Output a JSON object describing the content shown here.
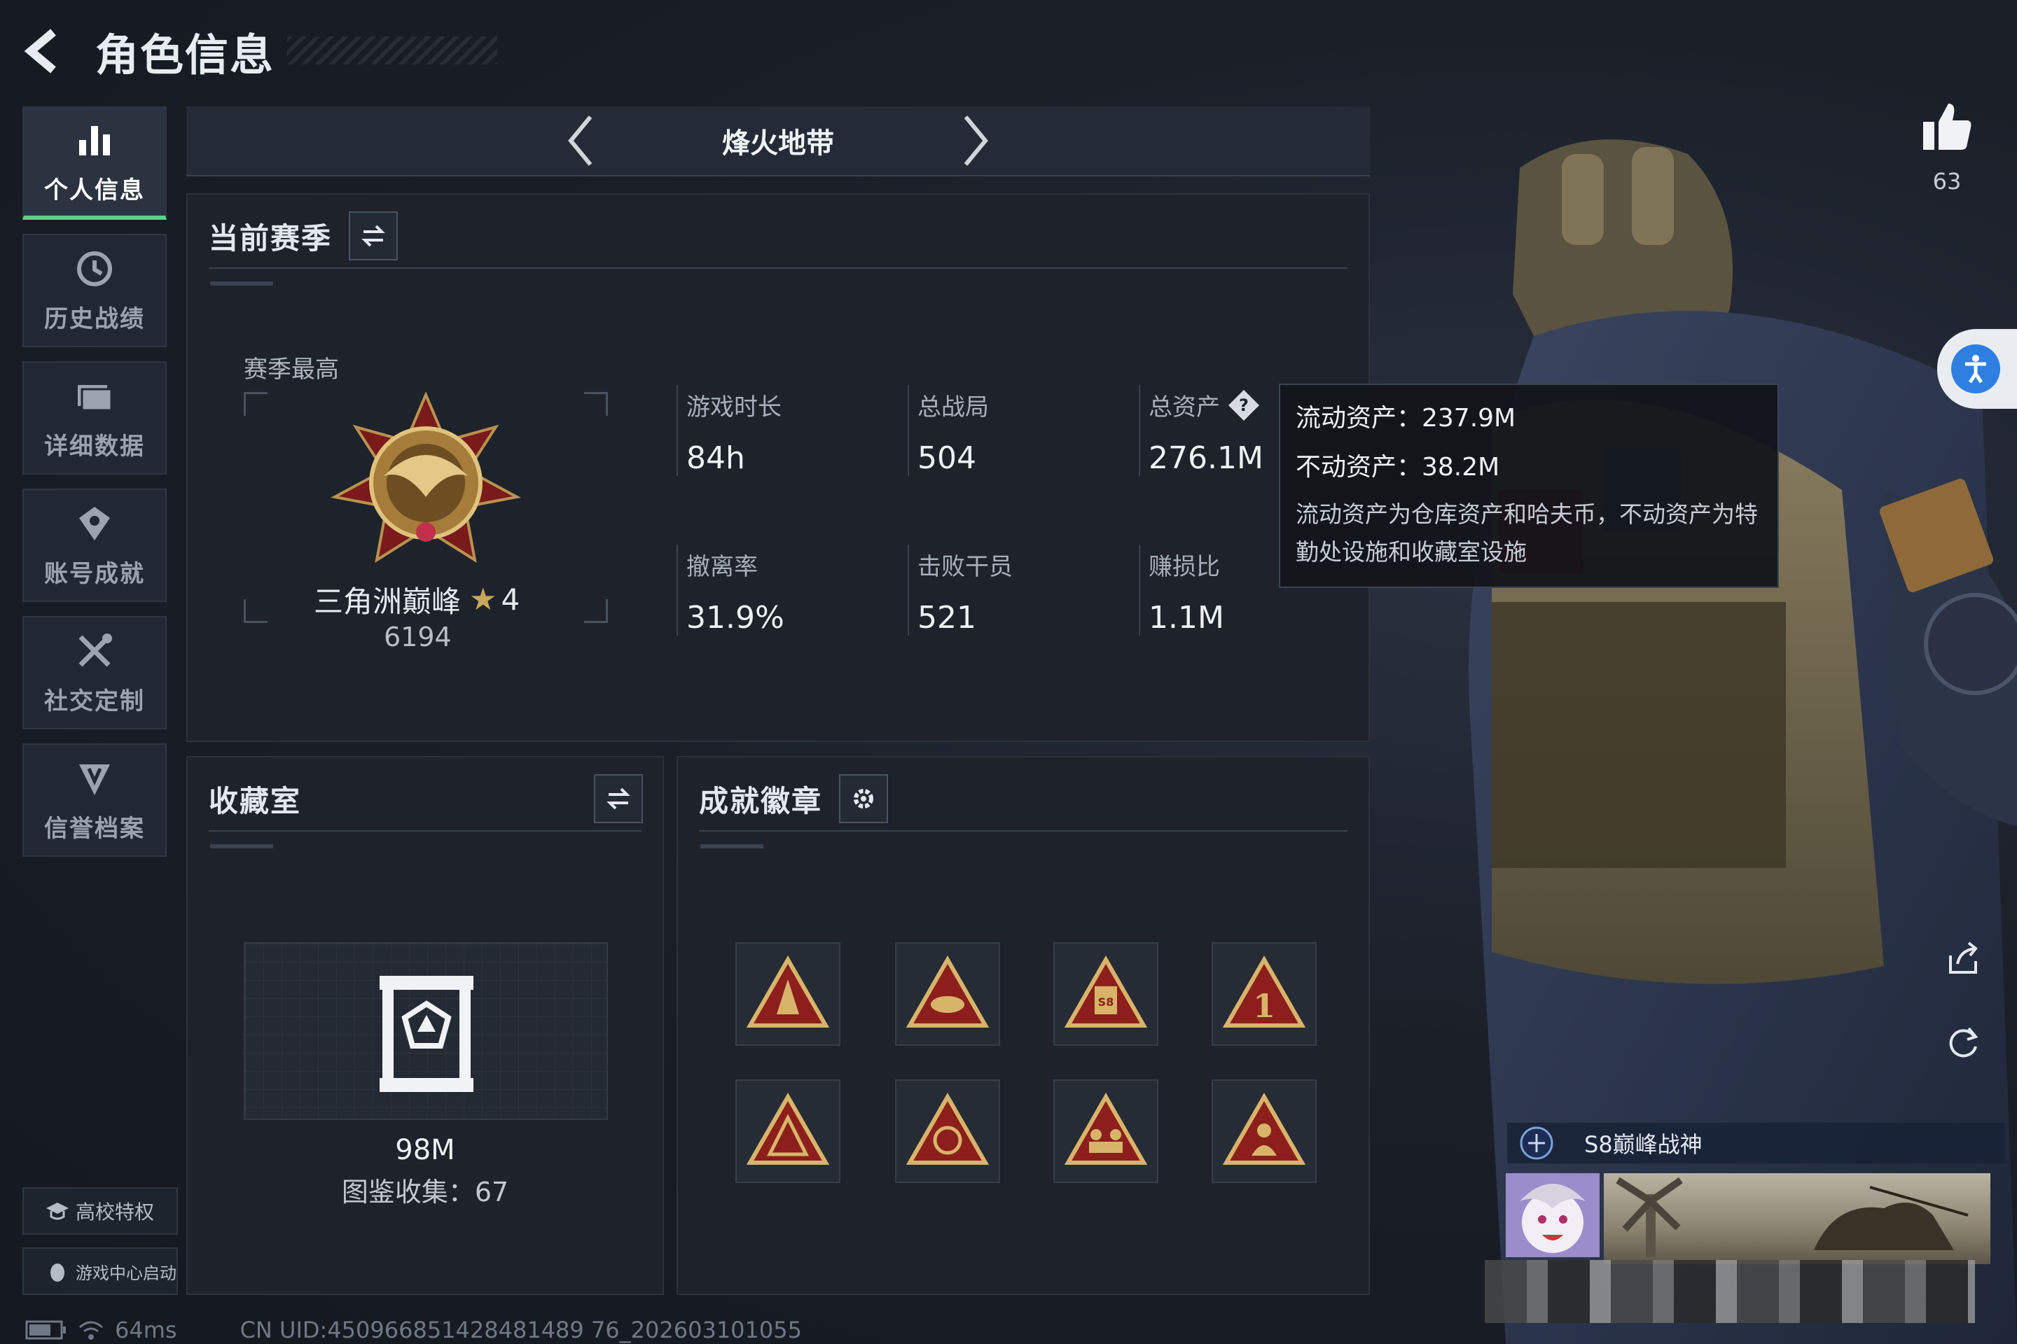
{
  "header": {
    "title": "角色信息"
  },
  "sidebar": {
    "items": [
      {
        "label": "个人信息",
        "icon": "bar-chart-icon",
        "active": true
      },
      {
        "label": "历史战绩",
        "icon": "history-icon"
      },
      {
        "label": "详细数据",
        "icon": "folder-icon"
      },
      {
        "label": "账号成就",
        "icon": "achievement-icon"
      },
      {
        "label": "社交定制",
        "icon": "tools-icon"
      },
      {
        "label": "信誉档案",
        "icon": "shield-icon"
      }
    ],
    "campus": "高校特权",
    "game_center": "游戏中心启动"
  },
  "mode": {
    "title": "烽火地带"
  },
  "season": {
    "title": "当前赛季",
    "best_label": "赛季最高",
    "rank_name": "三角洲巅峰",
    "rank_stars": "4",
    "rank_score": "6194",
    "stats": [
      {
        "label": "游戏时长",
        "value": "84h"
      },
      {
        "label": "总战局",
        "value": "504"
      },
      {
        "label": "总资产",
        "value": "276.1M"
      },
      {
        "label": "撤离率",
        "value": "31.9%"
      },
      {
        "label": "击败干员",
        "value": "521"
      },
      {
        "label": "赚损比",
        "value": "1.1M"
      }
    ]
  },
  "tooltip": {
    "liquid": "流动资产：237.9M",
    "fixed": "不动资产：38.2M",
    "note": "流动资产为仓库资产和哈夫币，不动资产为特勤处设施和收藏室设施"
  },
  "collection": {
    "title": "收藏室",
    "value": "98M",
    "count": "图鉴收集：67"
  },
  "badges": {
    "title": "成就徽章",
    "count": 8
  },
  "social": {
    "likes": "63",
    "title_text": "S8巅峰战神"
  },
  "footer": {
    "ping": "64ms",
    "uid": "CN UID:450966851428481489 76_202603101055"
  },
  "colors": {
    "accent_green": "#5bd08a",
    "gold": "#c7a85a",
    "badge_red": "#8c1f1c"
  }
}
